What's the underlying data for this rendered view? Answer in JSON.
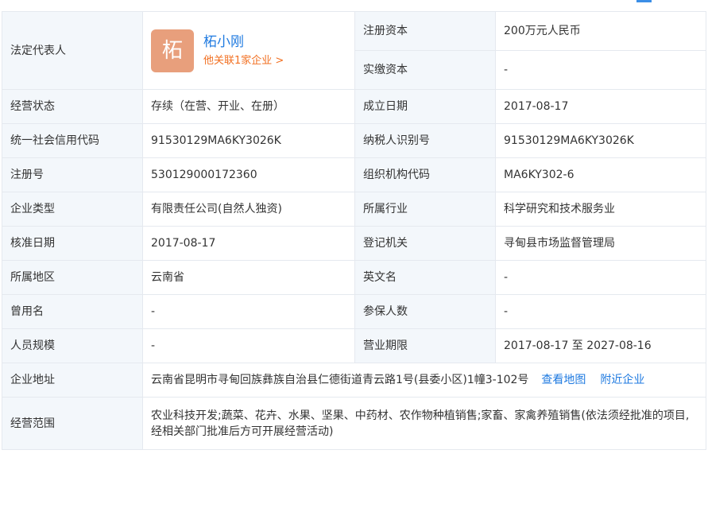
{
  "rows": {
    "legal_rep": {
      "label": "法定代表人",
      "avatar_char": "柘",
      "name": "柘小刚",
      "related": "他关联1家企业 >"
    },
    "registered_capital": {
      "label": "注册资本",
      "value": "200万元人民币"
    },
    "paid_capital": {
      "label": "实缴资本",
      "value": "-"
    },
    "status": {
      "label": "经营状态",
      "value": "存续（在营、开业、在册）"
    },
    "established": {
      "label": "成立日期",
      "value": "2017-08-17"
    },
    "credit_code": {
      "label": "统一社会信用代码",
      "value": "91530129MA6KY3026K"
    },
    "taxpayer_id": {
      "label": "纳税人识别号",
      "value": "91530129MA6KY3026K"
    },
    "reg_number": {
      "label": "注册号",
      "value": "530129000172360"
    },
    "org_code": {
      "label": "组织机构代码",
      "value": "MA6KY302-6"
    },
    "company_type": {
      "label": "企业类型",
      "value": "有限责任公司(自然人独资)"
    },
    "industry": {
      "label": "所属行业",
      "value": "科学研究和技术服务业"
    },
    "approval_date": {
      "label": "核准日期",
      "value": "2017-08-17"
    },
    "reg_authority": {
      "label": "登记机关",
      "value": "寻甸县市场监督管理局"
    },
    "region": {
      "label": "所属地区",
      "value": "云南省"
    },
    "english_name": {
      "label": "英文名",
      "value": "-"
    },
    "former_name": {
      "label": "曾用名",
      "value": "-"
    },
    "insured_count": {
      "label": "参保人数",
      "value": "-"
    },
    "staff_size": {
      "label": "人员规模",
      "value": "-"
    },
    "business_term": {
      "label": "营业期限",
      "value": "2017-08-17 至 2027-08-16"
    },
    "address": {
      "label": "企业地址",
      "value": "云南省昆明市寻甸回族彝族自治县仁德街道青云路1号(县委小区)1幢3-102号",
      "map_link": "查看地图",
      "nearby_link": "附近企业"
    },
    "scope": {
      "label": "经营范围",
      "value": "农业科技开发;蔬菜、花卉、水果、坚果、中药材、农作物种植销售;家畜、家禽养殖销售(依法须经批准的项目,经相关部门批准后方可开展经营活动)"
    }
  },
  "colors": {
    "label_bg": "#f3f7fb",
    "border": "#e5e9ef",
    "link": "#1f7ae0",
    "accent_orange": "#f27022",
    "avatar_bg": "#e89f7c"
  }
}
